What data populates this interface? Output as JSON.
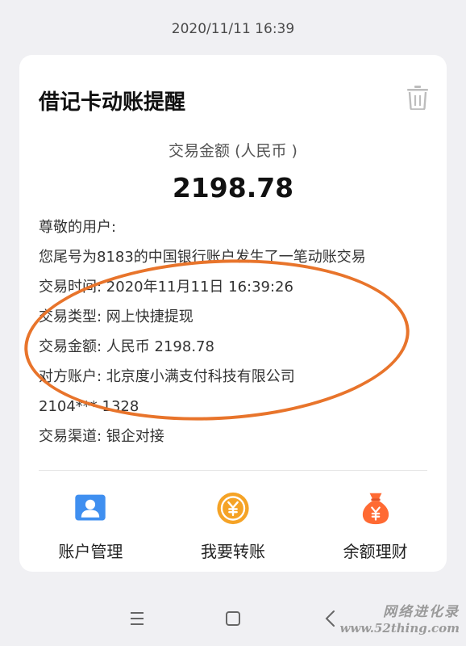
{
  "header": {
    "timestamp": "2020/11/11 16:39"
  },
  "card": {
    "title": "借记卡动账提醒",
    "amount_label": "交易金额 (人民币 )",
    "amount_value": "2198.78",
    "lines": [
      "尊敬的用户:",
      "您尾号为8183的中国银行账户发生了一笔动账交易",
      "交易时间: 2020年11月11日 16:39:26",
      "交易类型: 网上快捷提现",
      "交易金额: 人民币 2198.78",
      "对方账户: 北京度小满支付科技有限公司",
      "2104*** 1328",
      "交易渠道: 银企对接"
    ]
  },
  "actions": [
    {
      "label": "账户管理",
      "icon": "account-icon"
    },
    {
      "label": "我要转账",
      "icon": "transfer-coin-icon"
    },
    {
      "label": "余额理财",
      "icon": "money-bag-icon"
    }
  ],
  "colors": {
    "highlight": "#e8742b",
    "account_icon": "#3f8ff0",
    "transfer_icon": "#f5a326",
    "bag_icon": "#ff6a33"
  },
  "watermark": {
    "name": "网络进化录",
    "url": "www.52thing.com"
  }
}
